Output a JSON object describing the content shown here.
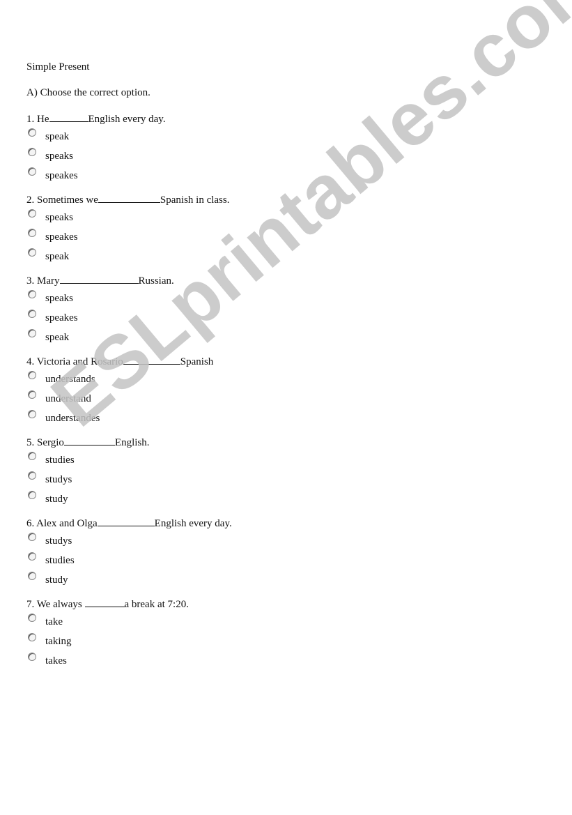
{
  "document": {
    "title": "Simple Present",
    "instruction": "A) Choose the correct option.",
    "questions": [
      {
        "before": "1. He",
        "after": "English every day.",
        "options": [
          "speak",
          "speaks",
          "speakes"
        ]
      },
      {
        "before": "2. Sometimes we",
        "after": "Spanish in class.",
        "options": [
          "speaks",
          "speakes",
          "speak"
        ]
      },
      {
        "before": "3. Mary",
        "after": "Russian.",
        "options": [
          "speaks",
          "speakes",
          "speak"
        ]
      },
      {
        "before": "4. Victoria and Rosario",
        "after": "Spanish",
        "options": [
          "understands",
          "understand",
          "understandes"
        ]
      },
      {
        "before": "5. Sergio",
        "after": "English.",
        "options": [
          "studies",
          "studys",
          "study"
        ]
      },
      {
        "before": "6. Alex and Olga",
        "after": "English every day.",
        "options": [
          "studys",
          "studies",
          "study"
        ]
      },
      {
        "before": "7. We always ",
        "after": "a break at 7:20.",
        "options": [
          "take",
          "taking",
          "takes"
        ]
      }
    ]
  },
  "watermark": {
    "text": "ESLprintables.com",
    "color": "#c4c4c4"
  }
}
